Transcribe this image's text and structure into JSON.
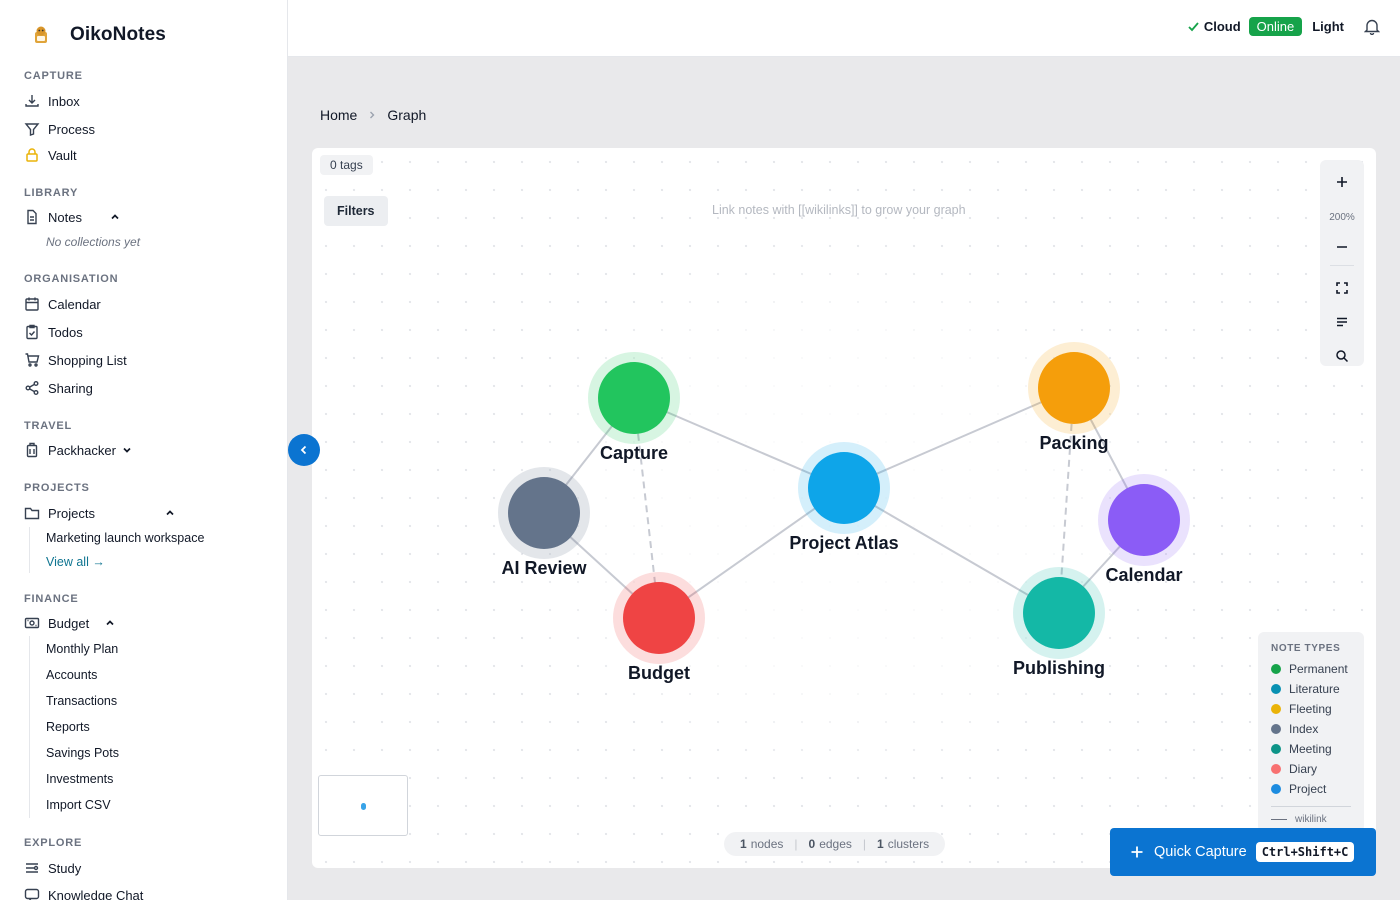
{
  "app": {
    "name": "OikoNotes"
  },
  "sidebar": {
    "capture": {
      "title": "CAPTURE",
      "items": [
        "Inbox",
        "Process",
        "Vault"
      ]
    },
    "library": {
      "title": "LIBRARY",
      "notes": "Notes",
      "empty": "No collections yet"
    },
    "organisation": {
      "title": "ORGANISATION",
      "items": [
        "Calendar",
        "Todos",
        "Shopping List",
        "Sharing"
      ]
    },
    "travel": {
      "title": "TRAVEL",
      "packhacker": "Packhacker"
    },
    "projects": {
      "title": "PROJECTS",
      "label": "Projects",
      "children": [
        "Marketing launch workspace"
      ],
      "view_all": "View all →"
    },
    "finance": {
      "title": "FINANCE",
      "label": "Budget",
      "children": [
        "Monthly Plan",
        "Accounts",
        "Transactions",
        "Reports",
        "Savings Pots",
        "Investments",
        "Import CSV"
      ]
    },
    "explore": {
      "title": "EXPLORE",
      "items": [
        "Study",
        "Knowledge Chat"
      ]
    }
  },
  "topbar": {
    "cloud": "Cloud",
    "online": "Online",
    "theme": "Light"
  },
  "breadcrumb": {
    "home": "Home",
    "current": "Graph"
  },
  "graph": {
    "tags": "0 tags",
    "filters": "Filters",
    "hint": "Link notes with [[wikilinks]] to grow your graph",
    "zoom": "200%",
    "nodes": [
      {
        "id": "capture",
        "label": "Capture",
        "color": "#22c55e"
      },
      {
        "id": "ai-review",
        "label": "AI Review",
        "color": "#64748b"
      },
      {
        "id": "budget",
        "label": "Budget",
        "color": "#ef4444"
      },
      {
        "id": "project-atlas",
        "label": "Project Atlas",
        "color": "#0ea5e9"
      },
      {
        "id": "packing",
        "label": "Packing",
        "color": "#f59e0b"
      },
      {
        "id": "calendar",
        "label": "Calendar",
        "color": "#8b5cf6"
      },
      {
        "id": "publishing",
        "label": "Publishing",
        "color": "#14b8a6"
      }
    ],
    "legend": {
      "title": "NOTE TYPES",
      "items": [
        {
          "label": "Permanent",
          "color": "#16a34a"
        },
        {
          "label": "Literature",
          "color": "#0891b2"
        },
        {
          "label": "Fleeting",
          "color": "#eab308"
        },
        {
          "label": "Index",
          "color": "#64748b"
        },
        {
          "label": "Meeting",
          "color": "#0d9488"
        },
        {
          "label": "Diary",
          "color": "#f87171"
        },
        {
          "label": "Project",
          "color": "#1d8ce0"
        }
      ],
      "wikilink": "wikilink"
    },
    "stats": {
      "nodes_value": "1",
      "nodes_label": "nodes",
      "edges_value": "0",
      "edges_label": "edges",
      "clusters_value": "1",
      "clusters_label": "clusters"
    }
  },
  "quick_capture": {
    "label": "Quick Capture",
    "shortcut": "Ctrl+Shift+C"
  },
  "colors": {
    "accent": "#0b74d1",
    "online": "#16a34a"
  }
}
